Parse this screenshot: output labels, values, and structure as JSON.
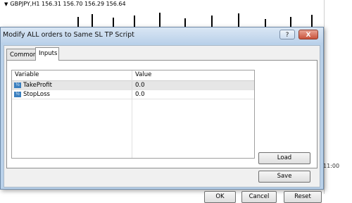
{
  "chart": {
    "symbol_line": "GBPJPY,H1  156.31 156.70 156.29 156.64",
    "time_label": "11:00"
  },
  "dialog": {
    "title": "Modify ALL orders to Same SL TP Script",
    "help_label": "?",
    "close_label": "X",
    "tabs": [
      {
        "label": "Common"
      },
      {
        "label": "Inputs"
      }
    ],
    "table": {
      "headers": {
        "variable": "Variable",
        "value": "Value"
      },
      "rows": [
        {
          "variable": "TakeProfit",
          "value": "0.0",
          "type_icon": "½"
        },
        {
          "variable": "StopLoss",
          "value": "0.0",
          "type_icon": "½"
        }
      ]
    },
    "buttons": {
      "load": "Load",
      "save": "Save",
      "ok": "OK",
      "cancel": "Cancel",
      "reset": "Reset"
    }
  }
}
